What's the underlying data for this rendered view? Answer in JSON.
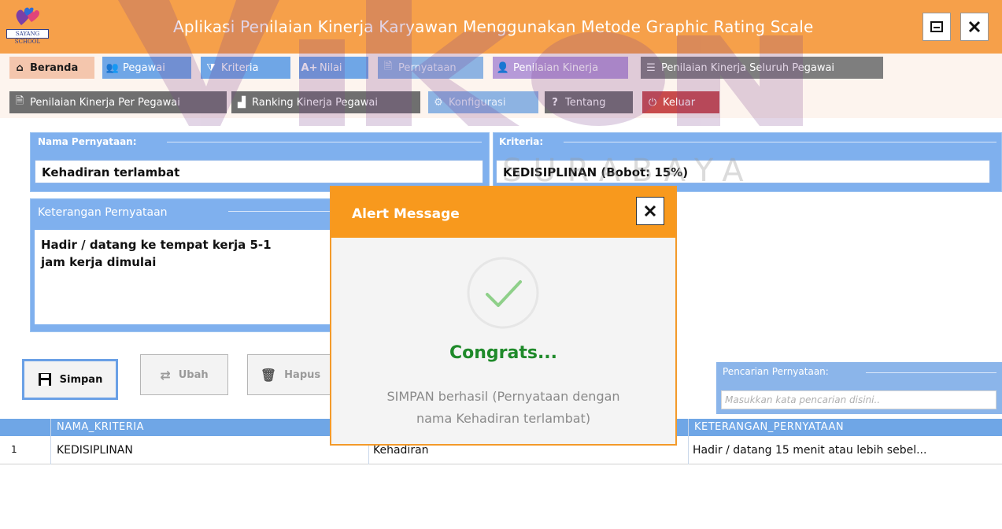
{
  "app": {
    "title": "Aplikasi Penilaian Kinerja Karyawan Menggunakan Metode Graphic Rating Scale",
    "logo_text": "SAYANG SCHOOL",
    "watermark_sub": "SURABAYA"
  },
  "window": {
    "minimize_icon": "minimize-icon",
    "close_icon": "close-icon"
  },
  "toolbar": {
    "row1": [
      {
        "label": "Beranda",
        "icon": "home-icon"
      },
      {
        "label": "Pegawai",
        "icon": "users-icon"
      },
      {
        "label": "Kriteria",
        "icon": "filter-icon"
      },
      {
        "label": "Nilai",
        "icon": "grade-icon"
      },
      {
        "label": "Pernyataan",
        "icon": "document-icon"
      },
      {
        "label": "Penilaian Kinerja",
        "icon": "person-icon"
      },
      {
        "label": "Penilaian Kinerja Seluruh Pegawai",
        "icon": "list-icon"
      }
    ],
    "row2": [
      {
        "label": "Penilaian Kinerja Per Pegawai",
        "icon": "document-icon"
      },
      {
        "label": "Ranking Kinerja Pegawai",
        "icon": "ranking-icon"
      },
      {
        "label": "Konfigurasi",
        "icon": "gear-icon"
      },
      {
        "label": "Tentang",
        "icon": "question-icon"
      },
      {
        "label": "Keluar",
        "icon": "power-icon"
      }
    ]
  },
  "form": {
    "nama_label": "Nama Pernyataan:",
    "nama_value": "Kehadiran terlambat",
    "kriteria_label": "Kriteria:",
    "kriteria_value": "KEDISIPLINAN (Bobot: 15%)",
    "keterangan_label": "Keterangan Pernyataan",
    "keterangan_line1": "Hadir / datang ke tempat kerja 5-1",
    "keterangan_line2": "jam kerja dimulai"
  },
  "buttons": {
    "simpan": "Simpan",
    "ubah": "Ubah",
    "hapus": "Hapus"
  },
  "search": {
    "label": "Pencarian Pernyataan:",
    "placeholder": "Masukkan kata pencarian disini.."
  },
  "table": {
    "columns": [
      "NAMA_KRITERIA",
      "KETERANGAN_PERNYATAAN"
    ],
    "rows": [
      {
        "no": "1",
        "kriteria": "KEDISIPLINAN",
        "nama": "Kehadiran",
        "keterangan": "Hadir / datang 15 menit atau lebih sebel..."
      }
    ]
  },
  "modal": {
    "title": "Alert Message",
    "heading": "Congrats...",
    "message_line1": "SIMPAN berhasil (Pernyataan dengan",
    "message_line2": "nama Kehadiran terlambat)"
  },
  "colors": {
    "titlebar": "#f6a04a",
    "accent_blue": "#6fa6e6",
    "modal_orange": "#f8991d",
    "success_green": "#1f8a2a"
  }
}
